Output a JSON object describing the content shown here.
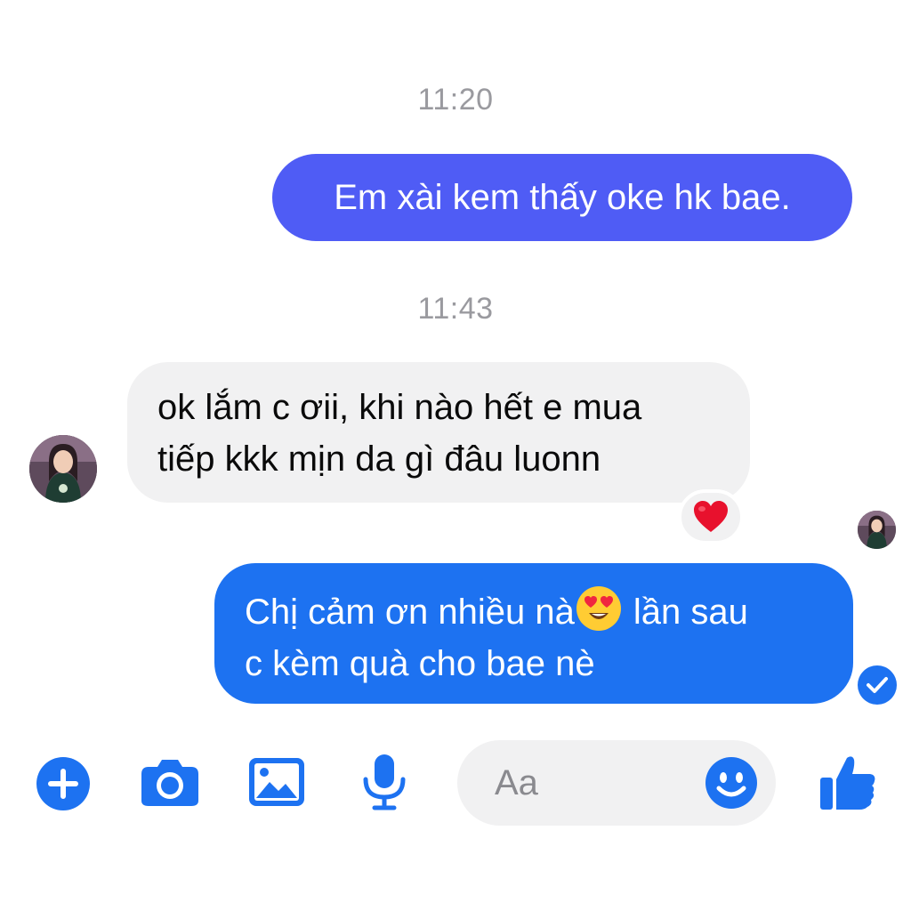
{
  "colors": {
    "outgoing_old": "#4f5cf5",
    "outgoing": "#1d72f1",
    "incoming": "#f1f1f2",
    "timestamp": "#9a9a9f",
    "accent": "#1d72f1"
  },
  "messages": [
    {
      "type": "timestamp",
      "text": "11:20"
    },
    {
      "type": "outgoing",
      "text": "Em xài kem thấy oke hk bae."
    },
    {
      "type": "timestamp",
      "text": "11:43"
    },
    {
      "type": "incoming",
      "lines": [
        "ok lắm c ơii, khi nào hết e mua",
        "tiếp kkk mịn da gì đâu luonn"
      ],
      "reaction": "heart-icon"
    },
    {
      "type": "outgoing",
      "lines": [
        "Chị cảm ơn nhiều nà",
        "lần sau",
        "c kèm quà cho bae nè"
      ],
      "emoji": "heart-eyes-emoji"
    }
  ],
  "composer": {
    "placeholder": "Aa",
    "icons": [
      "plus-icon",
      "camera-icon",
      "gallery-icon",
      "microphone-icon",
      "emoji-icon",
      "thumbs-up-icon"
    ]
  }
}
